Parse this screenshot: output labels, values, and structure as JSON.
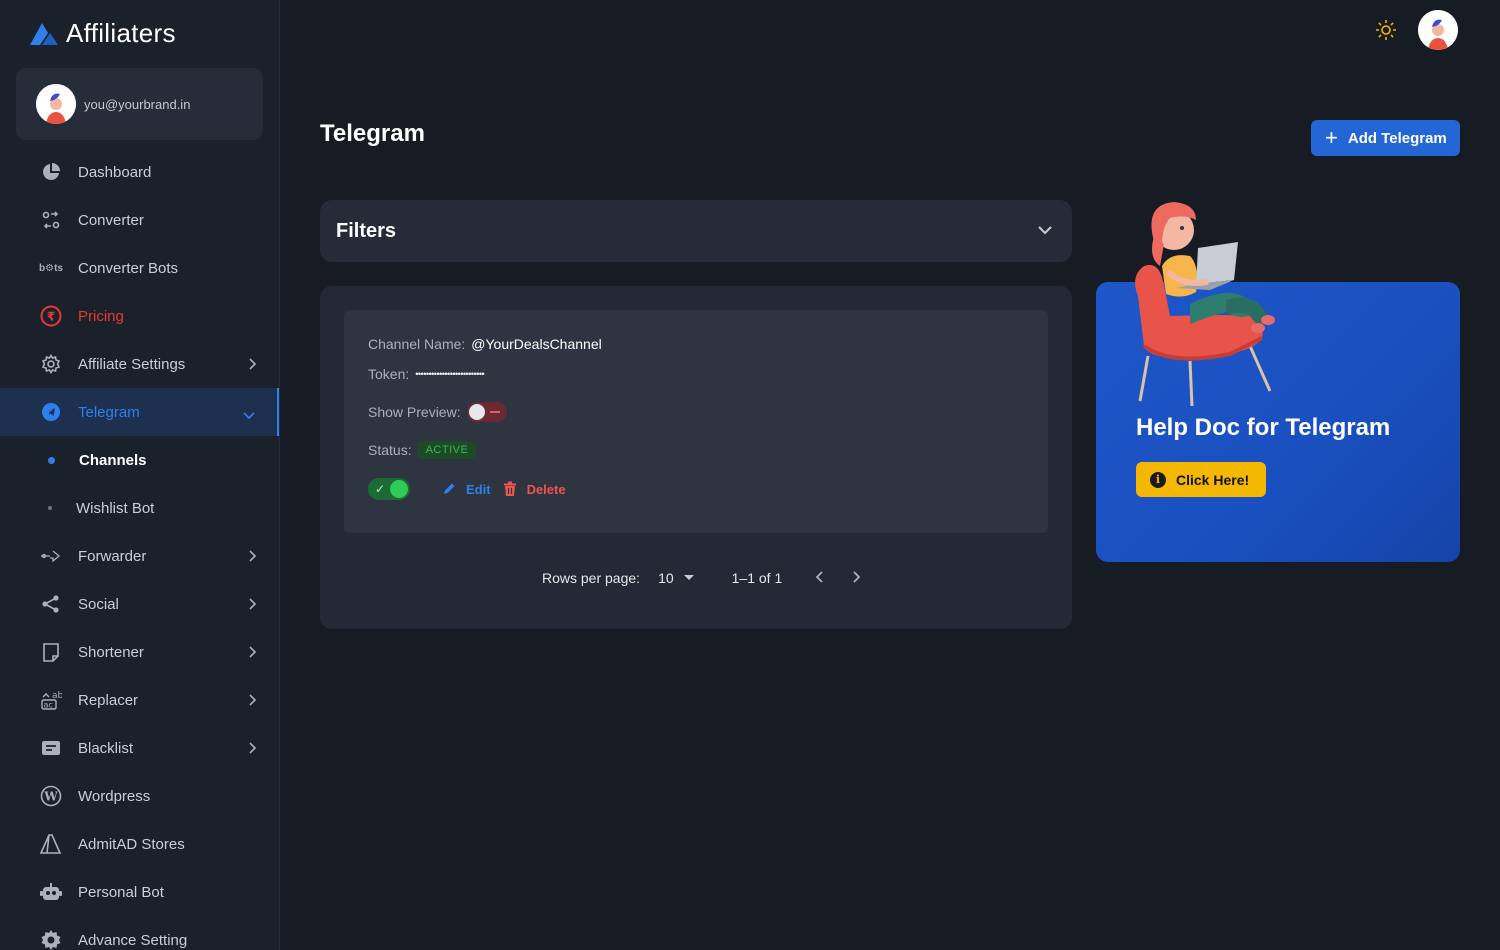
{
  "app": {
    "brand": "Affiliaters"
  },
  "user": {
    "email": "you@yourbrand.in"
  },
  "sidebar": {
    "items": [
      {
        "label": "Dashboard",
        "icon": "pie-chart-icon"
      },
      {
        "label": "Converter",
        "icon": "converter-icon"
      },
      {
        "label": "Converter Bots",
        "icon": "bots-icon"
      },
      {
        "label": "Pricing",
        "icon": "rupee-icon"
      },
      {
        "label": "Affiliate Settings",
        "icon": "gear-icon"
      },
      {
        "label": "Telegram",
        "icon": "telegram-icon"
      },
      {
        "label": "Channels"
      },
      {
        "label": "Wishlist Bot"
      },
      {
        "label": "Forwarder",
        "icon": "forward-icon"
      },
      {
        "label": "Social",
        "icon": "share-icon"
      },
      {
        "label": "Shortener",
        "icon": "shortener-icon"
      },
      {
        "label": "Replacer",
        "icon": "replace-icon"
      },
      {
        "label": "Blacklist",
        "icon": "blacklist-icon"
      },
      {
        "label": "Wordpress",
        "icon": "wordpress-icon"
      },
      {
        "label": "AdmitAD Stores",
        "icon": "admitad-icon"
      },
      {
        "label": "Personal Bot",
        "icon": "robot-icon"
      },
      {
        "label": "Advance Setting",
        "icon": "gear-filled-icon"
      }
    ]
  },
  "main": {
    "title": "Telegram",
    "add_button": "Add Telegram",
    "filters_title": "Filters",
    "card": {
      "channel_label": "Channel Name:",
      "channel_value": "@YourDealsChannel",
      "token_label": "Token:",
      "token_value": "••••••••••••••••••••••••••",
      "preview_label": "Show Preview:",
      "preview_enabled": false,
      "status_label": "Status:",
      "status_value": "ACTIVE",
      "enabled": true,
      "edit_label": "Edit",
      "delete_label": "Delete"
    },
    "pager": {
      "rows_label": "Rows per page:",
      "rows_value": "10",
      "range": "1–1 of 1"
    }
  },
  "help": {
    "title": "Help Doc for Telegram",
    "button": "Click Here!"
  },
  "colors": {
    "accent": "#2f80ed",
    "pricing": "#e53935",
    "help_button": "#f5b800",
    "status_active": "#2fbf4f"
  }
}
